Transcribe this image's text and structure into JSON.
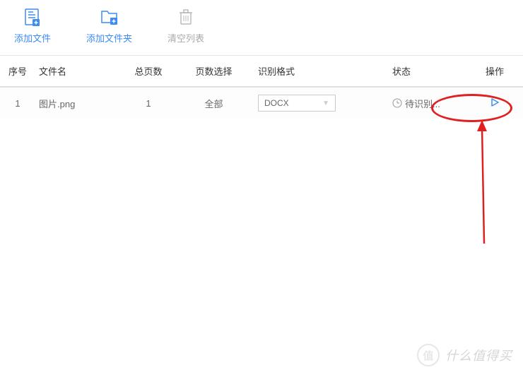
{
  "toolbar": {
    "addFile": "添加文件",
    "addFolder": "添加文件夹",
    "clearList": "清空列表"
  },
  "headers": {
    "index": "序号",
    "filename": "文件名",
    "totalPages": "总页数",
    "pageSelect": "页数选择",
    "format": "识别格式",
    "status": "状态",
    "action": "操作"
  },
  "rows": [
    {
      "index": "1",
      "filename": "图片.png",
      "totalPages": "1",
      "pageSelect": "全部",
      "format": "DOCX",
      "status": "待识别..."
    }
  ],
  "watermark": "什么值得买"
}
